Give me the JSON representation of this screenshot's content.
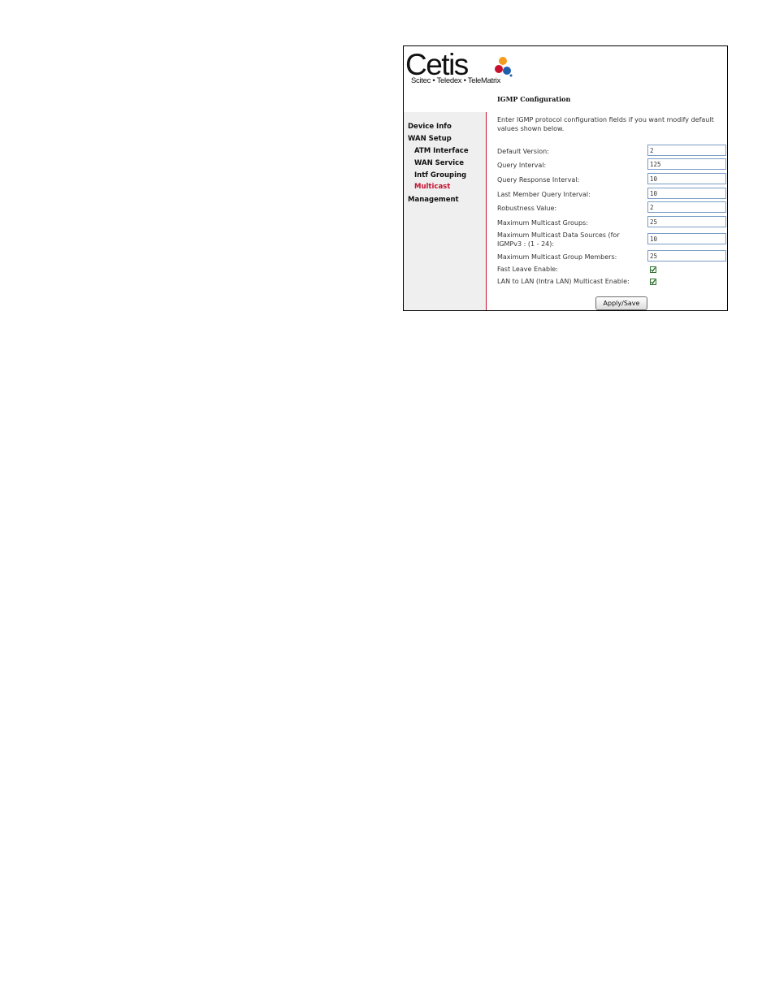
{
  "brand": {
    "name": "Cetis",
    "tagline": "Scitec • Teledex • TeleMatrix",
    "logo_colors": [
      "#f39c1f",
      "#c8102e",
      "#1f5fae"
    ]
  },
  "sidebar": {
    "items": [
      {
        "label": "Device Info"
      },
      {
        "label": "WAN Setup"
      },
      {
        "label": "ATM Interface"
      },
      {
        "label": "WAN Service"
      },
      {
        "label": "Intf Grouping"
      },
      {
        "label": "Multicast",
        "active": true
      },
      {
        "label": "Management"
      }
    ]
  },
  "main": {
    "title": "IGMP Configuration",
    "intro": "Enter IGMP protocol configuration fields if you want modify default values shown below.",
    "fields": [
      {
        "label": "Default Version:",
        "value": "2"
      },
      {
        "label": "Query Interval:",
        "value": "125"
      },
      {
        "label": "Query Response Interval:",
        "value": "10"
      },
      {
        "label": "Last Member Query Interval:",
        "value": "10"
      },
      {
        "label": "Robustness Value:",
        "value": "2"
      },
      {
        "label": "Maximum Multicast Groups:",
        "value": "25"
      },
      {
        "label": "Maximum Multicast Data Sources (for IGMPv3 : (1 - 24):",
        "value": "10"
      },
      {
        "label": "Maximum Multicast Group Members:",
        "value": "25"
      }
    ],
    "checkboxes": [
      {
        "label": "Fast Leave Enable:",
        "checked": true
      },
      {
        "label": "LAN to LAN (Intra LAN) Multicast Enable:",
        "checked": true
      }
    ],
    "apply_label": "Apply/Save"
  },
  "colors": {
    "accent": "#c8102e",
    "input_border": "#7a9cc6",
    "check": "#2e6f2e"
  }
}
